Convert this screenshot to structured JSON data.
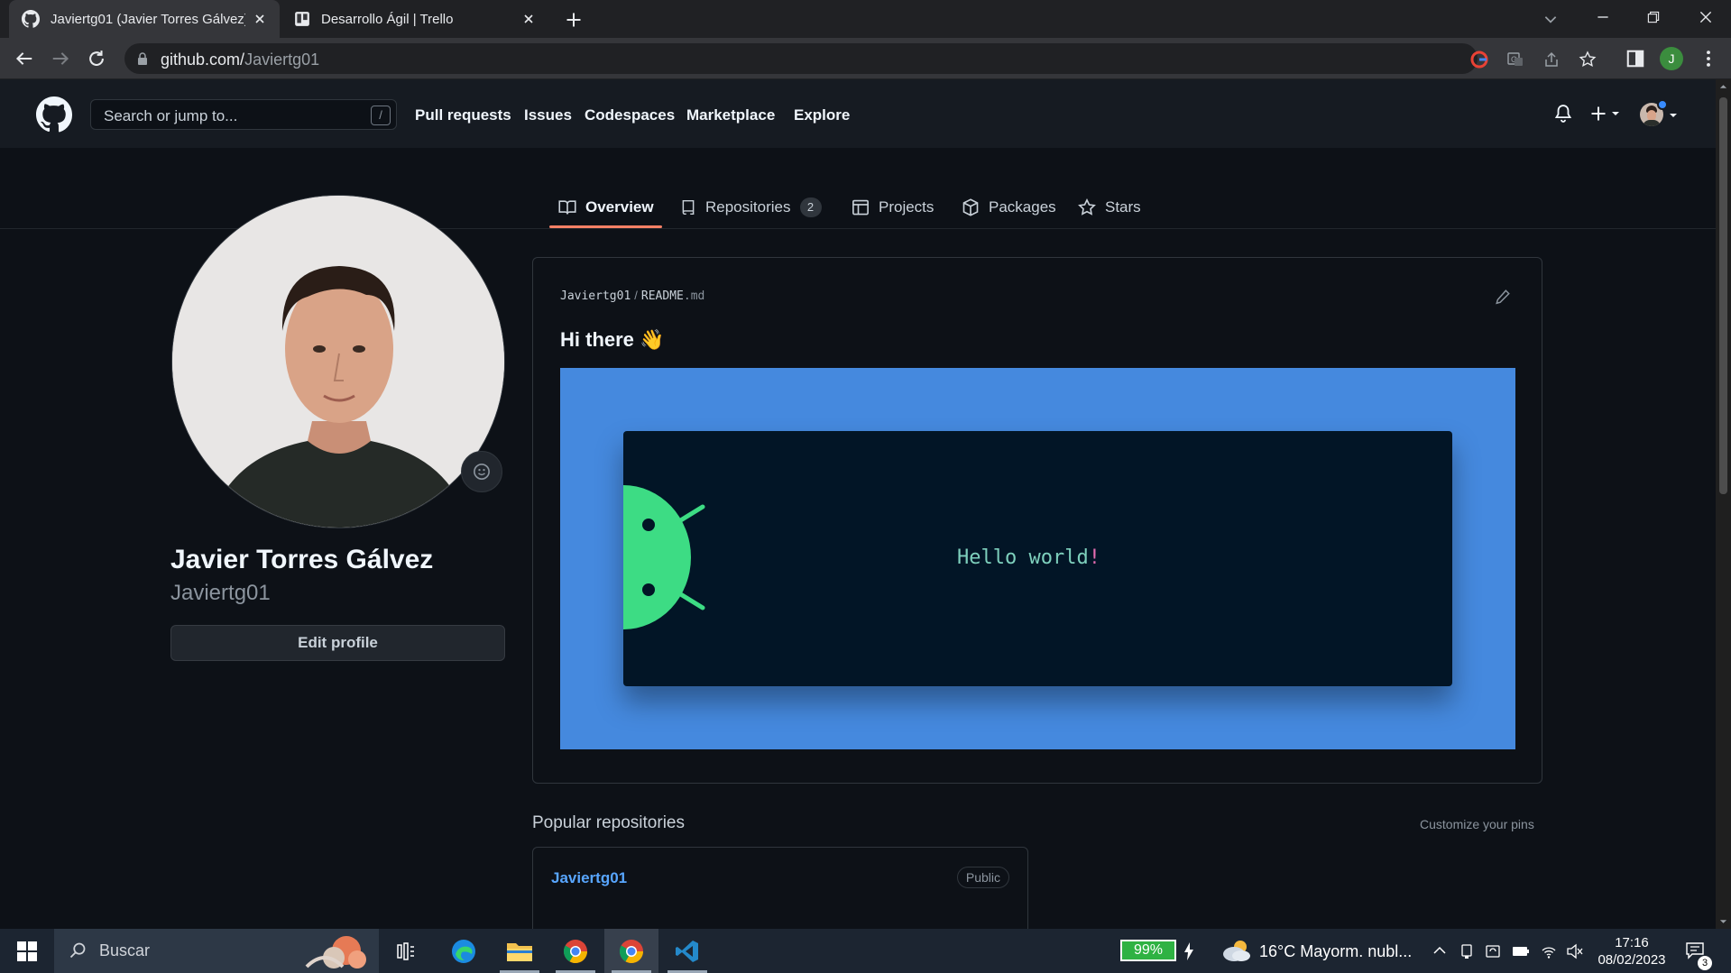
{
  "browser": {
    "tabs": [
      {
        "title": "Javiertg01 (Javier Torres Gálvez)",
        "active": true
      },
      {
        "title": "Desarrollo Ágil | Trello",
        "active": false
      }
    ],
    "url_host": "github.com/",
    "url_path": "Javiertg01",
    "profile_initial": "J"
  },
  "github": {
    "search_placeholder": "Search or jump to...",
    "search_shortcut": "/",
    "nav": [
      "Pull requests",
      "Issues",
      "Codespaces",
      "Marketplace",
      "Explore"
    ],
    "profile_tabs": [
      {
        "label": "Overview",
        "icon": "book-icon",
        "selected": true
      },
      {
        "label": "Repositories",
        "icon": "repo-icon",
        "count": "2"
      },
      {
        "label": "Projects",
        "icon": "table-icon"
      },
      {
        "label": "Packages",
        "icon": "package-icon"
      },
      {
        "label": "Stars",
        "icon": "star-icon"
      }
    ]
  },
  "profile": {
    "full_name": "Javier Torres Gálvez",
    "username": "Javiertg01",
    "edit_button": "Edit profile"
  },
  "readme": {
    "owner": "Javiertg01",
    "separator": "/",
    "file_name": "README",
    "file_ext": ".md",
    "heading": "Hi there 👋",
    "banner_text": "Hello world",
    "banner_bang": "!"
  },
  "popular": {
    "title": "Popular repositories",
    "customize": "Customize your pins",
    "repos": [
      {
        "name": "Javiertg01",
        "visibility": "Public"
      }
    ]
  },
  "taskbar": {
    "search_placeholder": "Buscar",
    "battery": "99%",
    "weather": "16°C  Mayorm. nubl...",
    "time": "17:16",
    "date": "08/02/2023",
    "notifications": "3"
  },
  "colors": {
    "accent_underline": "#f78166",
    "link": "#58a6ff",
    "banner_bg": "#4589de",
    "android_green": "#3ddc84"
  }
}
